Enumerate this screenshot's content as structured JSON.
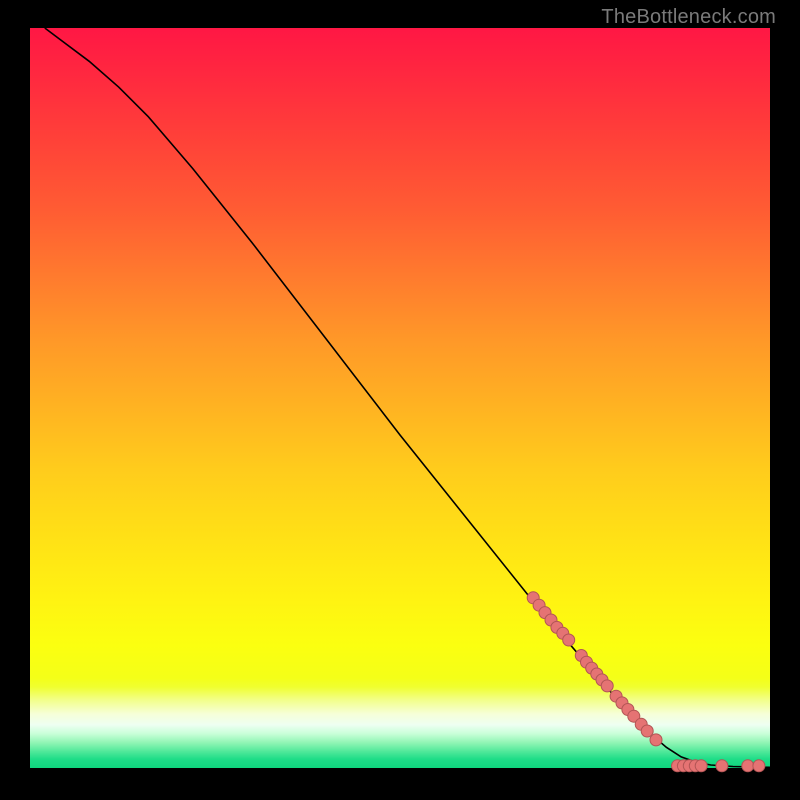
{
  "watermark": "TheBottleneck.com",
  "chart_data": {
    "type": "line",
    "title": "",
    "xlabel": "",
    "ylabel": "",
    "xlim": [
      0,
      100
    ],
    "ylim": [
      0,
      100
    ],
    "grid": false,
    "curve": [
      {
        "x": 2,
        "y": 100
      },
      {
        "x": 4,
        "y": 98.5
      },
      {
        "x": 8,
        "y": 95.5
      },
      {
        "x": 12,
        "y": 92
      },
      {
        "x": 16,
        "y": 88
      },
      {
        "x": 22,
        "y": 81
      },
      {
        "x": 30,
        "y": 71
      },
      {
        "x": 40,
        "y": 58
      },
      {
        "x": 50,
        "y": 45
      },
      {
        "x": 60,
        "y": 32.5
      },
      {
        "x": 68,
        "y": 22.5
      },
      {
        "x": 74,
        "y": 15.5
      },
      {
        "x": 80,
        "y": 8.5
      },
      {
        "x": 84,
        "y": 4.5
      },
      {
        "x": 86,
        "y": 2.8
      },
      {
        "x": 88,
        "y": 1.5
      },
      {
        "x": 90,
        "y": 0.8
      },
      {
        "x": 92,
        "y": 0.4
      },
      {
        "x": 95,
        "y": 0.2
      },
      {
        "x": 100,
        "y": 0.1
      }
    ],
    "markers": [
      {
        "x": 68.0,
        "y": 23.0
      },
      {
        "x": 68.8,
        "y": 22.0
      },
      {
        "x": 69.6,
        "y": 21.0
      },
      {
        "x": 70.4,
        "y": 20.0
      },
      {
        "x": 71.2,
        "y": 19.0
      },
      {
        "x": 72.0,
        "y": 18.2
      },
      {
        "x": 72.8,
        "y": 17.3
      },
      {
        "x": 74.5,
        "y": 15.2
      },
      {
        "x": 75.2,
        "y": 14.3
      },
      {
        "x": 75.9,
        "y": 13.5
      },
      {
        "x": 76.6,
        "y": 12.7
      },
      {
        "x": 77.3,
        "y": 11.9
      },
      {
        "x": 78.0,
        "y": 11.1
      },
      {
        "x": 79.2,
        "y": 9.7
      },
      {
        "x": 80.0,
        "y": 8.8
      },
      {
        "x": 80.8,
        "y": 7.9
      },
      {
        "x": 81.6,
        "y": 7.0
      },
      {
        "x": 82.6,
        "y": 5.9
      },
      {
        "x": 83.4,
        "y": 5.0
      },
      {
        "x": 84.6,
        "y": 3.8
      },
      {
        "x": 87.5,
        "y": 0.3
      },
      {
        "x": 88.3,
        "y": 0.3
      },
      {
        "x": 89.1,
        "y": 0.3
      },
      {
        "x": 89.9,
        "y": 0.3
      },
      {
        "x": 90.7,
        "y": 0.3
      },
      {
        "x": 93.5,
        "y": 0.3
      },
      {
        "x": 97.0,
        "y": 0.3
      },
      {
        "x": 98.5,
        "y": 0.3
      }
    ],
    "marker_radius_px": 6,
    "background": {
      "kind": "vertical-gradient",
      "stops": [
        {
          "pos": 0.0,
          "color": "#ff1744"
        },
        {
          "pos": 0.3,
          "color": "#ff6a30"
        },
        {
          "pos": 0.55,
          "color": "#ffc21e"
        },
        {
          "pos": 0.78,
          "color": "#fff312"
        },
        {
          "pos": 0.9,
          "color": "#f6ffd8"
        },
        {
          "pos": 1.0,
          "color": "#0fd77e"
        }
      ]
    }
  }
}
